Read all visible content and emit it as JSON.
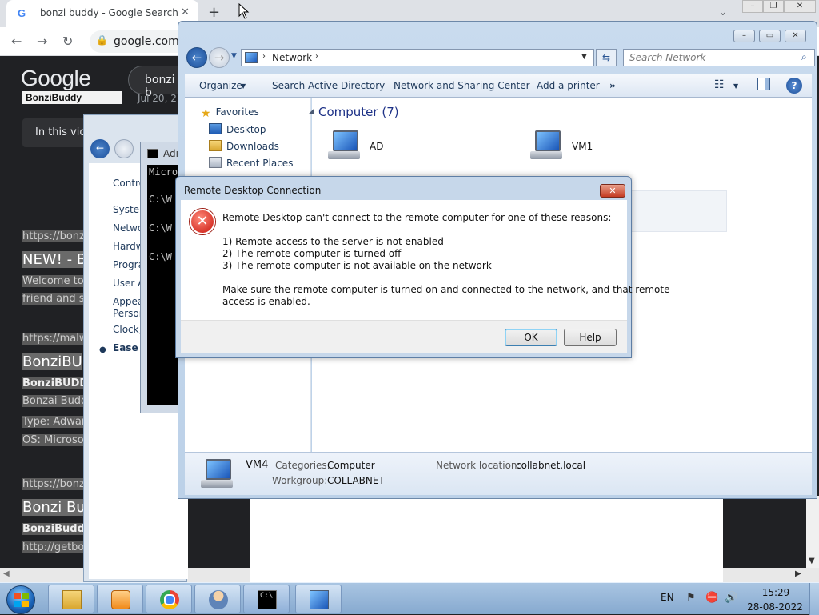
{
  "chrome": {
    "tab_title": "bonzi buddy - Google Search",
    "tab_favicon": "G",
    "tab_close": "✕",
    "new_tab": "+",
    "url": "google.com/",
    "window_minimize": "–",
    "window_restore": "❐",
    "window_close": "✕",
    "tab_search": "⌄"
  },
  "google": {
    "logo": "Google",
    "query": "bonzi b",
    "thumb_label": "BonziBuddy",
    "video_date": "Jul 20, 2",
    "video_snippet": "In this vid",
    "results": [
      {
        "kind": "url",
        "text": "https://bonzi"
      },
      {
        "kind": "h",
        "text": "NEW! - B"
      },
      {
        "kind": "p",
        "text": "Welcome to"
      },
      {
        "kind": "p",
        "text": "friend and si"
      },
      {
        "kind": "url",
        "text": "https://malw"
      },
      {
        "kind": "h",
        "text": "BonziBU"
      },
      {
        "kind": "b",
        "text": "BonziBUDD"
      },
      {
        "kind": "p",
        "text": "Bonzai Budd"
      },
      {
        "kind": "p",
        "text": "Type: Adwar"
      },
      {
        "kind": "p",
        "text": "OS: Microso"
      },
      {
        "kind": "url",
        "text": "https://bonzi"
      },
      {
        "kind": "h",
        "text": "Bonzi Bu"
      },
      {
        "kind": "b",
        "text": "BonziBuddy"
      },
      {
        "kind": "p",
        "text": "http://getbon"
      }
    ]
  },
  "control_panel": {
    "items": [
      "Contro",
      "System",
      "Netwo",
      "Hardw",
      "Progra",
      "User A",
      "Appea",
      "Person",
      "Clock,",
      "Ease o"
    ]
  },
  "cmd": {
    "title": "Adı",
    "lines": [
      "Micro",
      "C:\\W",
      "C:\\W",
      "C:\\W"
    ]
  },
  "network": {
    "address_crumb": "Network",
    "search_placeholder": "Search Network",
    "toolbar": {
      "organize": "Organize",
      "search_ad": "Search Active Directory",
      "sharing_center": "Network and Sharing Center",
      "add_printer": "Add a printer",
      "more": "»"
    },
    "nav": {
      "favorites": "Favorites",
      "desktop": "Desktop",
      "downloads": "Downloads",
      "recent_places": "Recent Places"
    },
    "group_title": "Computer (7)",
    "computers": [
      "AD",
      "VM1"
    ],
    "details": {
      "name": "VM4",
      "categories_label": "Categories:",
      "categories_value": "Computer",
      "workgroup_label": "Workgroup:",
      "workgroup_value": "COLLABNET",
      "location_label": "Network location:",
      "location_value": "collabnet.local"
    }
  },
  "rdc": {
    "title": "Remote Desktop Connection",
    "close": "✕",
    "message": "Remote Desktop can't connect to the remote computer for one of these reasons:",
    "reasons": [
      "1) Remote access to the server is not enabled",
      "2) The remote computer is turned off",
      "3) The remote computer is not available on the network"
    ],
    "advice_line1": "Make sure the remote computer is turned on and connected to the network, and that remote",
    "advice_line2": "access is enabled.",
    "ok_label": "OK",
    "help_label": "Help"
  },
  "taskbar": {
    "language": "EN",
    "time": "15:29",
    "date": "28-08-2022",
    "apps": [
      "explorer-icon",
      "media-player-icon",
      "chrome-icon",
      "users-icon",
      "cmd-icon",
      "network-icon"
    ]
  },
  "colors": {
    "accent_blue": "#1e3287",
    "error_red": "#c8140c",
    "taskbar": "#a9c5e2"
  }
}
